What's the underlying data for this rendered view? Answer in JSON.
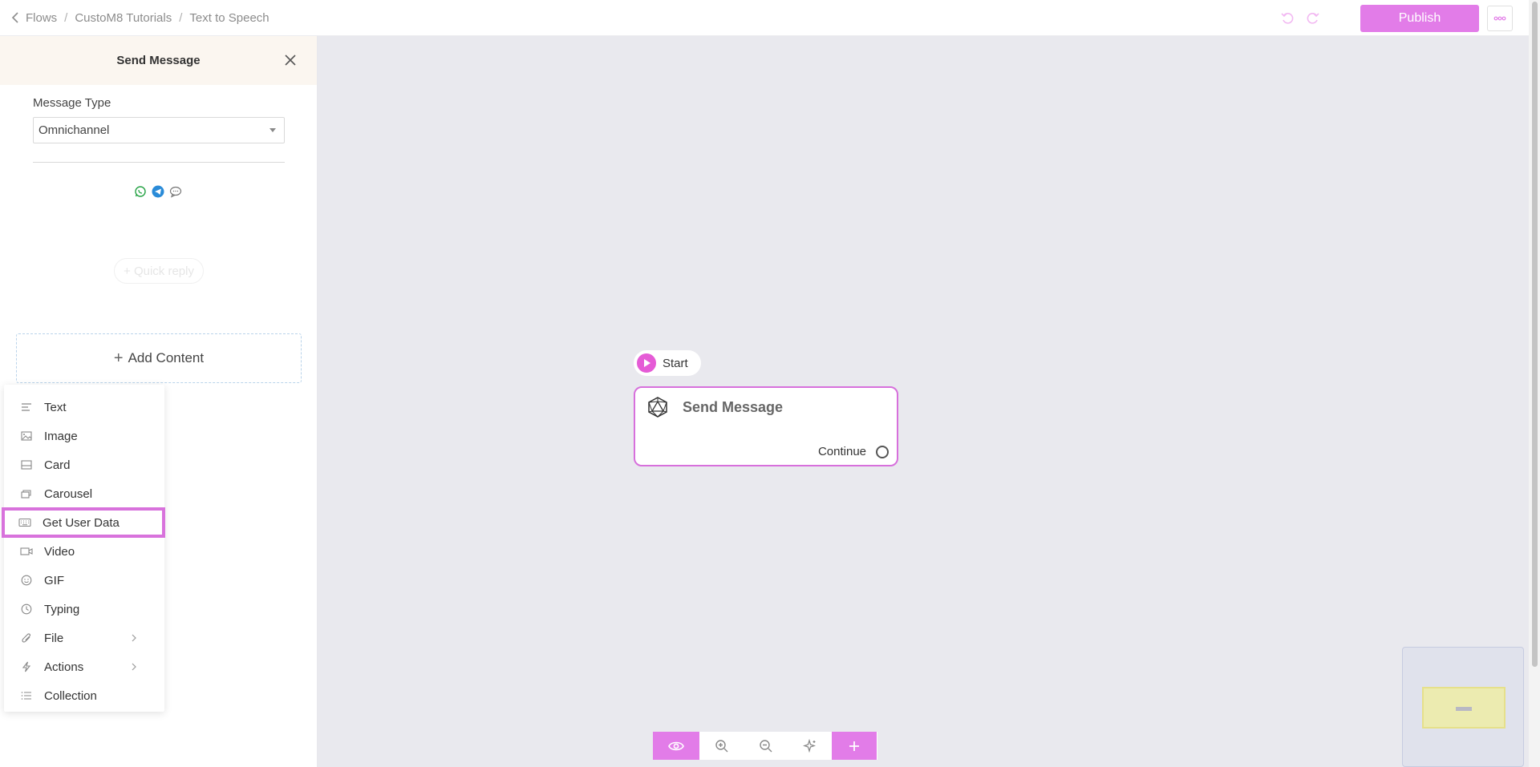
{
  "breadcrumb": {
    "items": [
      "Flows",
      "CustoM8 Tutorials",
      "Text to Speech"
    ]
  },
  "header": {
    "publish_label": "Publish"
  },
  "panel": {
    "title": "Send Message",
    "message_type_label": "Message Type",
    "message_type_value": "Omnichannel",
    "channels": [
      "whatsapp-icon",
      "telegram-icon",
      "chat-bubble-icon"
    ],
    "quick_reply_label": "+ Quick reply",
    "add_content_label": "Add Content"
  },
  "menu": {
    "items": [
      {
        "label": "Text",
        "icon": "text-icon"
      },
      {
        "label": "Image",
        "icon": "image-icon"
      },
      {
        "label": "Card",
        "icon": "card-icon"
      },
      {
        "label": "Carousel",
        "icon": "carousel-icon"
      },
      {
        "label": "Get User Data",
        "icon": "keyboard-icon",
        "highlighted": true
      },
      {
        "label": "Video",
        "icon": "video-icon"
      },
      {
        "label": "GIF",
        "icon": "gif-icon"
      },
      {
        "label": "Typing",
        "icon": "clock-icon"
      },
      {
        "label": "File",
        "icon": "paperclip-icon",
        "submenu": true
      },
      {
        "label": "Actions",
        "icon": "lightning-icon",
        "submenu": true
      },
      {
        "label": "Collection",
        "icon": "list-icon"
      }
    ]
  },
  "canvas": {
    "start_label": "Start",
    "node_title": "Send Message",
    "node_output_label": "Continue"
  },
  "colors": {
    "accent": "#e27ce8",
    "node_border": "#d770dc",
    "canvas_bg": "#e9e9ee",
    "panel_header_bg": "#fbf6f0"
  }
}
